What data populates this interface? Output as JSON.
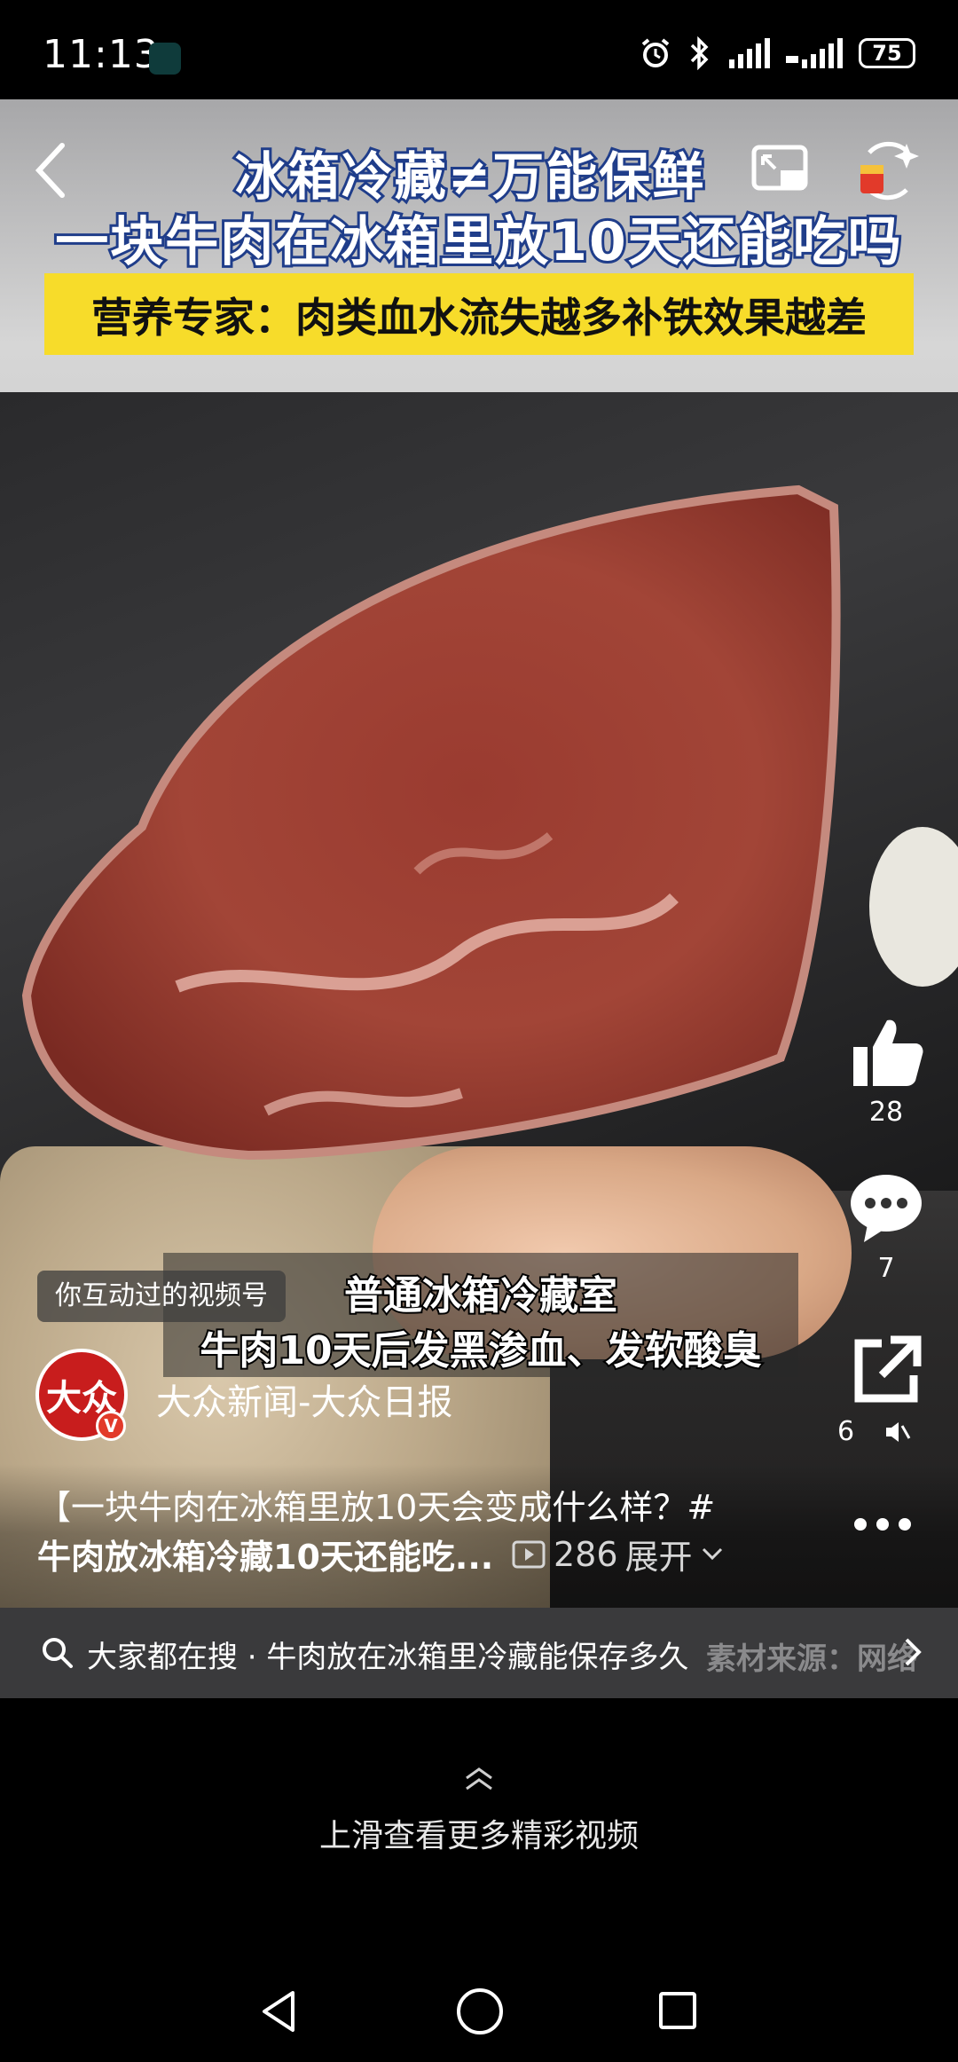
{
  "status_bar": {
    "time": "11:13",
    "battery": "75"
  },
  "video": {
    "title_line1": "冰箱冷藏≠万能保鲜",
    "title_line2": "一块牛肉在冰箱里放10天还能吃吗",
    "banner": "营养专家：肉类血水流失越多补铁效果越差",
    "subtitle_line1": "普通冰箱冷藏室",
    "subtitle_line2": "牛肉10天后发黑渗血、发软酸臭",
    "interacted_tag": "你互动过的视频号"
  },
  "actions": {
    "like_count": "28",
    "comment_count": "7",
    "share_count": "6"
  },
  "account": {
    "avatar_text": "大众",
    "verified_badge": "V",
    "name": "大众新闻-大众日报"
  },
  "description": {
    "line1": "【一块牛肉在冰箱里放10天会变成什么样？#",
    "line2": "牛肉放冰箱冷藏10天还能吃...",
    "play_count": "286",
    "expand_label": "展开"
  },
  "search": {
    "text": "大家都在搜 · 牛肉放在冰箱里冷藏能保存多久",
    "watermark": "素材来源：网络"
  },
  "swipe_hint": "上滑查看更多精彩视频",
  "colors": {
    "banner_yellow": "#f7dc2a",
    "title_stroke": "#1f3d8a",
    "avatar_red": "#c81d1d"
  }
}
